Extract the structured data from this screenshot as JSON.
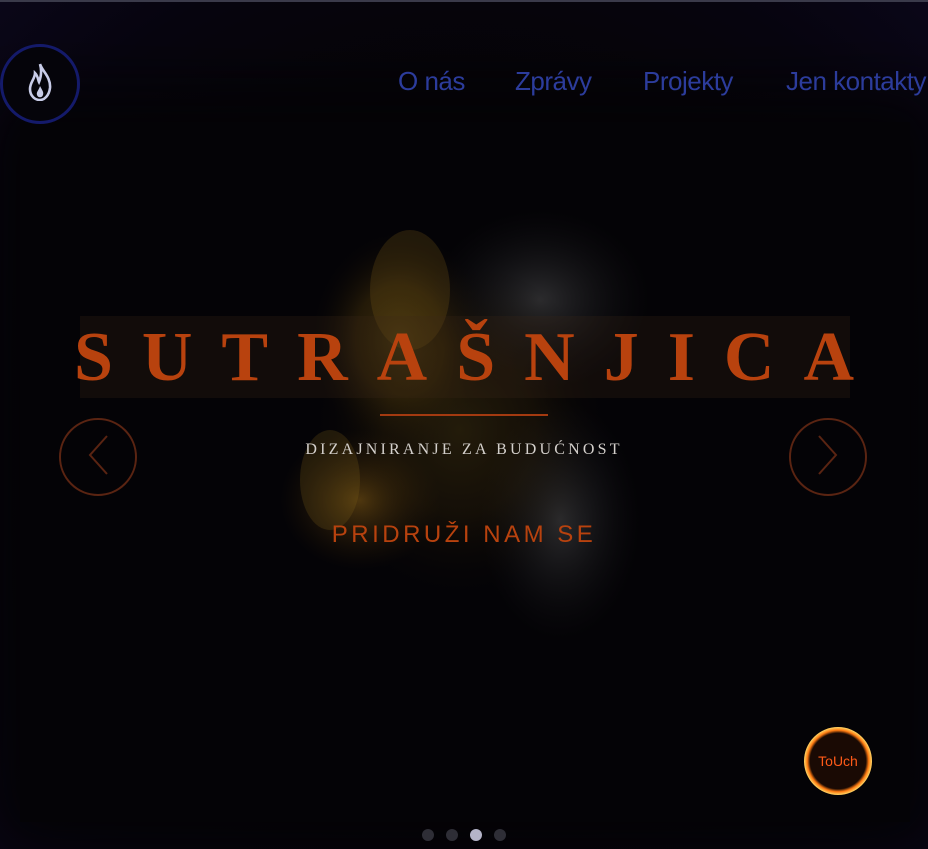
{
  "header": {
    "logo_icon": "flame-icon",
    "nav": [
      {
        "label": "O nás"
      },
      {
        "label": "Zprávy"
      },
      {
        "label": "Projekty"
      },
      {
        "label": "Jen kontakty"
      }
    ]
  },
  "hero": {
    "title": "SUTRAŠNJICA",
    "subtitle": "DIZAJNIRANJE ZA BUDUĆNOST",
    "cta": "PRIDRUŽI NAM SE",
    "prev_icon": "chevron-left-icon",
    "next_icon": "chevron-right-icon"
  },
  "touch_button": {
    "label": "ToUch"
  },
  "slider": {
    "total": 4,
    "active_index": 2
  },
  "colors": {
    "accent": "#b8420e",
    "nav": "#2c3c9c",
    "background": "#0a0618"
  }
}
